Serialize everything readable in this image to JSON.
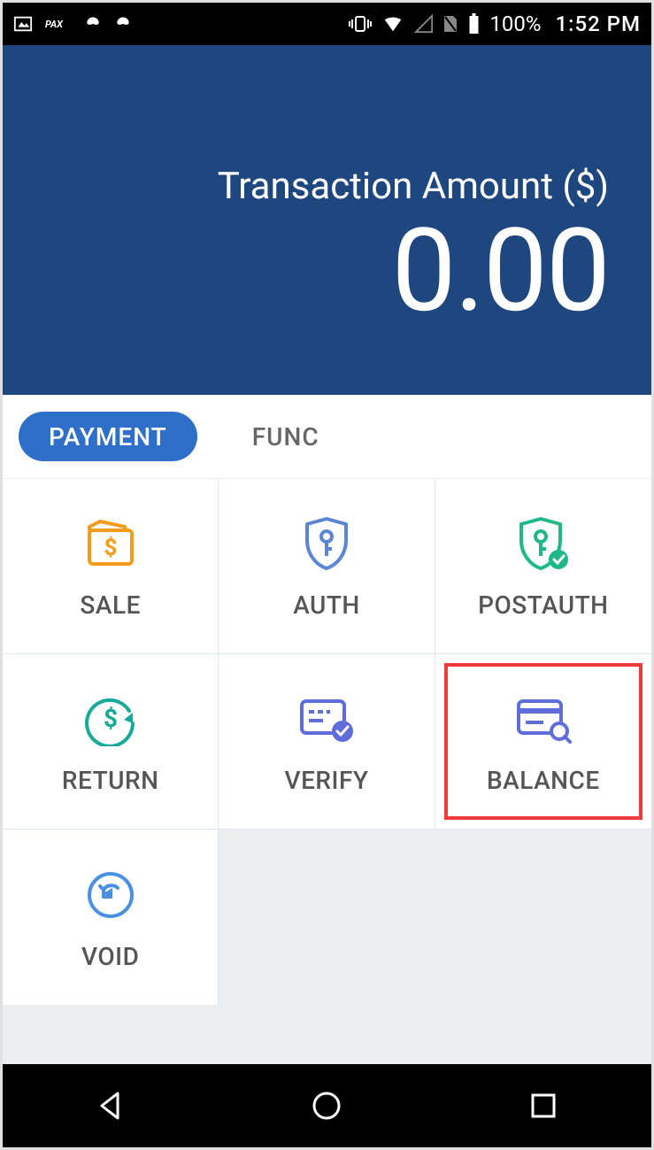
{
  "status_bar": {
    "battery_pct": "100%",
    "time": "1:52 PM"
  },
  "amount": {
    "label": "Transaction Amount ($)",
    "value": "0.00"
  },
  "tabs": {
    "payment": "PAYMENT",
    "func": "FUNC"
  },
  "grid": {
    "sale": {
      "label": "SALE"
    },
    "auth": {
      "label": "AUTH"
    },
    "postauth": {
      "label": "POSTAUTH"
    },
    "return": {
      "label": "RETURN"
    },
    "verify": {
      "label": "VERIFY"
    },
    "balance": {
      "label": "BALANCE"
    },
    "void": {
      "label": "VOID"
    }
  },
  "highlighted": "balance"
}
